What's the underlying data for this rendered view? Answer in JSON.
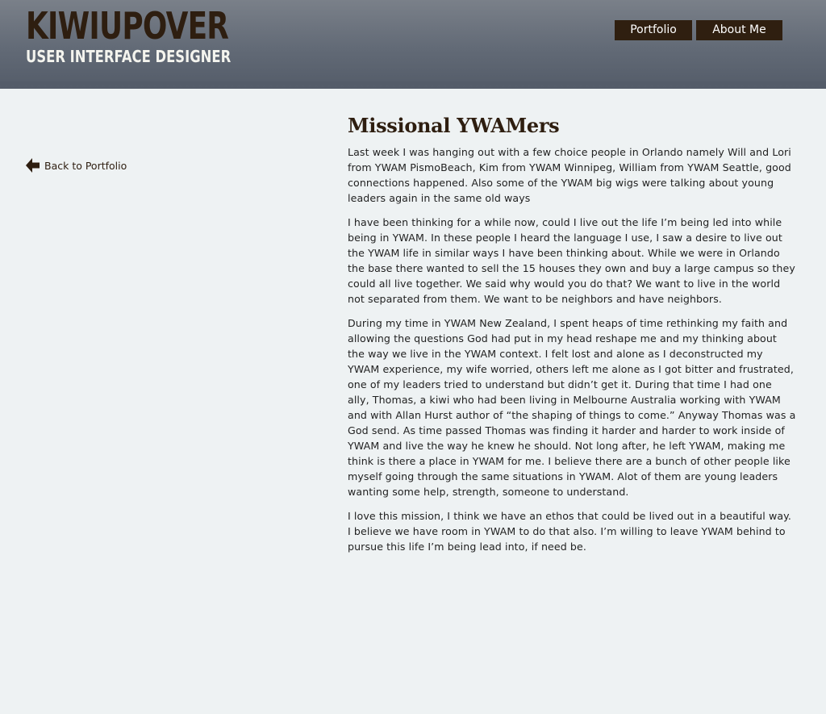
{
  "header": {
    "logo_title": "KIWIUPOVER",
    "logo_subtitle": "USER INTERFACE DESIGNER",
    "title_color": "#2e1e10",
    "background_color": "#626a76"
  },
  "nav": {
    "items": [
      {
        "label": "Portfolio"
      },
      {
        "label": "About Me"
      }
    ],
    "button_color": "#2f1f10"
  },
  "sidebar": {
    "back_icon": "arrow-left-icon",
    "back_label": "Back to Portfolio"
  },
  "article": {
    "title": "Missional YWAMers",
    "paragraphs": [
      "Last week I was hanging out with a few choice people in Orlando namely Will and Lori from YWAM PismoBeach, Kim from YWAM Winnipeg, William from YWAM Seattle, good connections happened. Also some of the YWAM big wigs were talking about young leaders again in the same old ways",
      "I have been thinking for a while now, could I live out the life I’m being led into while being in YWAM. In these people I heard the language I use, I saw a desire to live out the YWAM life in similar ways I have been thinking about. While we were in Orlando the base there wanted to sell the 15 houses they own and buy a large campus so they could all live together. We said why would you do that? We want to live in the world not separated from them. We want to be neighbors and have neighbors.",
      "During my time in YWAM New Zealand, I spent heaps of time rethinking my faith and allowing the questions God had put in my head reshape me and my thinking about the way we live in the YWAM context. I felt lost and alone as I deconstructed my YWAM experience, my wife worried, others left me alone as I got bitter and frustrated, one of my leaders tried to understand but didn’t get it. During that time I had one ally, Thomas, a kiwi who had been living in Melbourne Australia working with YWAM and with Allan Hurst author of “the shaping of things to come.” Anyway Thomas was a God send. As time passed Thomas was finding it harder and harder to work inside of YWAM and live the way he knew he should. Not long after, he left YWAM, making me think is there a place in YWAM for me. I believe there are a bunch of other people like myself going through the same situations in YWAM. Alot of them are young leaders wanting some help, strength, someone to understand.",
      "I love this mission, I think we have an ethos that could be lived out in a beautiful way. I believe we have room in YWAM to do that also. I’m willing to leave YWAM behind to pursue this life I’m being lead into, if need be."
    ]
  }
}
